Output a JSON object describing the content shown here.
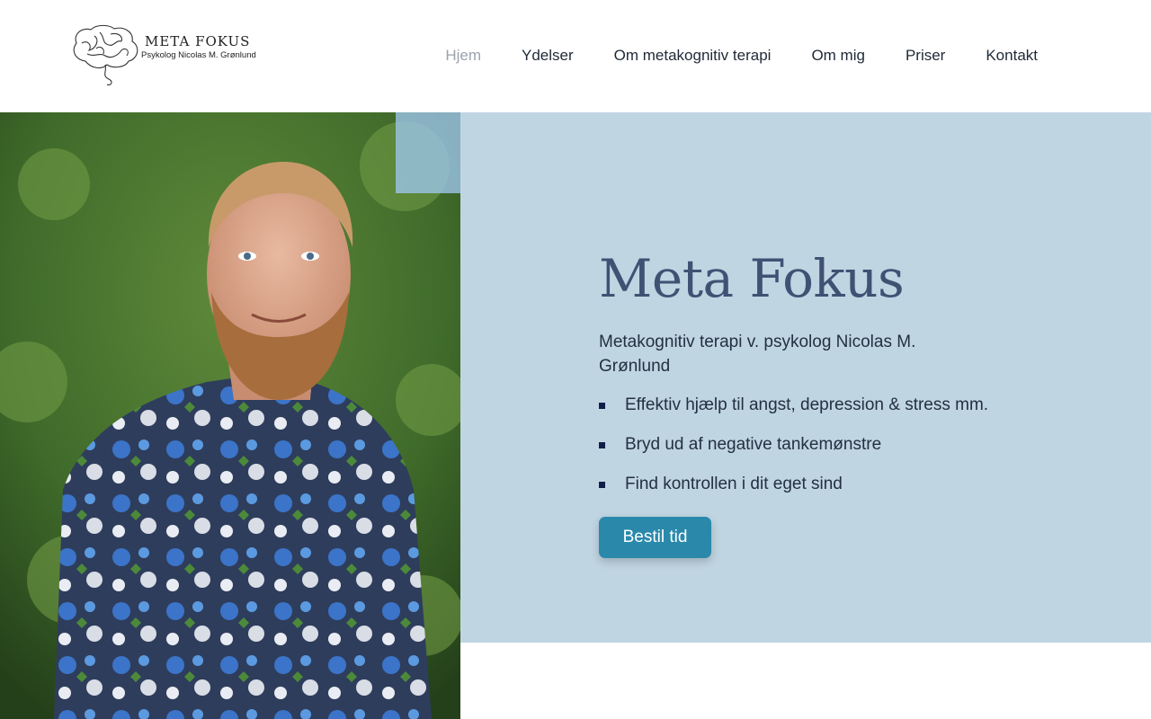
{
  "logo": {
    "title": "META FOKUS",
    "subtitle": "Psykolog Nicolas M. Grønlund",
    "icon": "brain-line-icon"
  },
  "nav": {
    "items": [
      {
        "label": "Hjem",
        "active": true
      },
      {
        "label": "Ydelser",
        "active": false
      },
      {
        "label": "Om metakognitiv terapi",
        "active": false
      },
      {
        "label": "Om mig",
        "active": false
      },
      {
        "label": "Priser",
        "active": false
      },
      {
        "label": "Kontakt",
        "active": false
      }
    ]
  },
  "hero": {
    "title": "Meta Fokus",
    "subtitle": "Metakognitiv terapi v. psykolog Nicolas M. Grønlund",
    "bullets": [
      "Effektiv hjælp til angst, depression & stress mm.",
      "Bryd ud af negative tankemønstre",
      "Find kontrollen i dit eget sind"
    ],
    "cta_label": "Bestil tid",
    "background_color": "#c0d5e2",
    "title_color": "#3f5274",
    "button_color": "#2a89ab"
  },
  "photo": {
    "icon": "portrait-photo"
  }
}
